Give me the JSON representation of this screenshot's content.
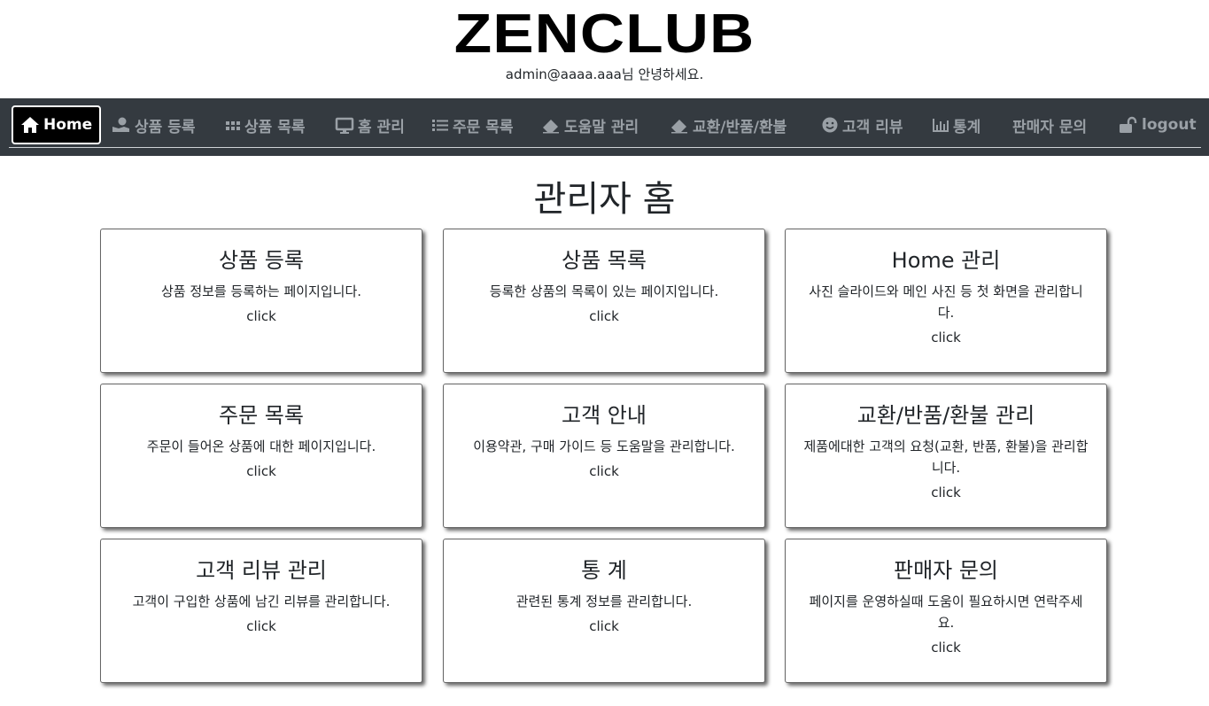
{
  "app": {
    "logo": "ZENCLUB",
    "greeting": "admin@aaaa.aaa님 안녕하세요."
  },
  "nav": {
    "items": [
      {
        "label": "Home",
        "icon": "home-icon",
        "active": true
      },
      {
        "label": "상품 등록",
        "icon": "user-hand-icon"
      },
      {
        "label": "상품 목록",
        "icon": "grid-dots-icon"
      },
      {
        "label": "홈 관리",
        "icon": "monitor-icon"
      },
      {
        "label": "주문 목록",
        "icon": "list-icon"
      },
      {
        "label": "도움말 관리",
        "icon": "eraser-icon"
      },
      {
        "label": "교환/반품/환불",
        "icon": "eraser-icon"
      },
      {
        "label": "고객 리뷰",
        "icon": "smile-icon"
      },
      {
        "label": "통계",
        "icon": "bar-chart-icon"
      },
      {
        "label": "판매자 문의",
        "icon": ""
      },
      {
        "label": "logout",
        "icon": "unlock-icon"
      }
    ]
  },
  "page": {
    "title": "관리자 홈"
  },
  "cards": [
    {
      "title": "상품 등록",
      "desc": "상품 정보를 등록하는 페이지입니다.",
      "click": "click"
    },
    {
      "title": "상품 목록",
      "desc": "등록한 상품의 목록이 있는 페이지입니다.",
      "click": "click"
    },
    {
      "title": "Home 관리",
      "desc": "사진 슬라이드와 메인 사진 등 첫 화면을 관리합니다.",
      "click": "click"
    },
    {
      "title": "주문 목록",
      "desc": "주문이 들어온 상품에 대한 페이지입니다.",
      "click": "click"
    },
    {
      "title": "고객 안내",
      "desc": "이용약관, 구매 가이드 등 도움말을 관리합니다.",
      "click": "click"
    },
    {
      "title": "교환/반품/환불 관리",
      "desc": "제품에대한 고객의 요청(교환, 반품, 환불)을 관리합니다.",
      "click": "click"
    },
    {
      "title": "고객 리뷰 관리",
      "desc": "고객이 구입한 상품에 남긴 리뷰를 관리합니다.",
      "click": "click"
    },
    {
      "title": "통 계",
      "desc": "관련된 통계 정보를 관리합니다.",
      "click": "click"
    },
    {
      "title": "판매자 문의",
      "desc": "페이지를 운영하실때 도움이 필요하시면 연락주세요.",
      "click": "click"
    }
  ],
  "colors": {
    "navbar_bg": "#343a40",
    "nav_text": "#9aa0a6",
    "active_bg": "#000000",
    "active_text": "#ffffff"
  }
}
